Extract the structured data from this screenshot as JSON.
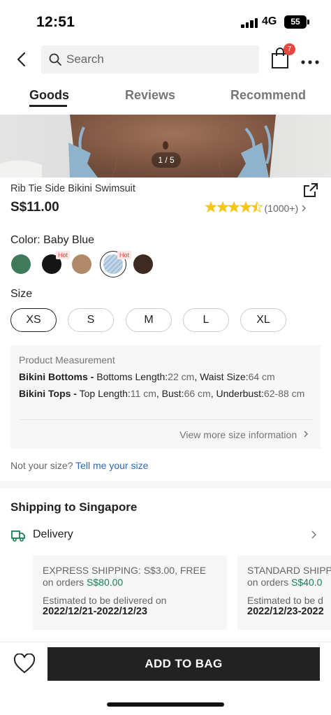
{
  "status_bar": {
    "time": "12:51",
    "network": "4G",
    "battery": "55"
  },
  "nav": {
    "search_placeholder": "Search",
    "cart_count": "7",
    "icons": [
      "back-icon",
      "search-icon",
      "bag-icon",
      "more-icon"
    ]
  },
  "tabs": [
    {
      "label": "Goods",
      "active": true
    },
    {
      "label": "Reviews",
      "active": false
    },
    {
      "label": "Recommend",
      "active": false
    }
  ],
  "gallery": {
    "counter": "1 / 5"
  },
  "product": {
    "title": "Rib Tie Side Bikini Swimsuit",
    "price": "S$11.00",
    "rating_value": 4.5,
    "rating_count": "(1000+)",
    "star_color": "#f5c518"
  },
  "color": {
    "label": "Color: Baby Blue",
    "selected": "Baby Blue",
    "hot_tag": "Hot",
    "swatches": [
      {
        "hex": "#3f7a5b",
        "hot": false
      },
      {
        "hex": "#151515",
        "hot": true
      },
      {
        "hex": "#b08a68",
        "hot": false
      },
      {
        "hex": "#a7c3dc",
        "hot": true,
        "selected": true
      },
      {
        "hex": "#3e2a22",
        "hot": false
      }
    ]
  },
  "size": {
    "label": "Size",
    "options": [
      "XS",
      "S",
      "M",
      "L",
      "XL"
    ],
    "selected": "XS"
  },
  "measurement": {
    "title": "Product Measurement",
    "bottoms": {
      "name": "Bikini Bottoms -",
      "length_label": "Bottoms Length:",
      "length_value": "22 cm",
      "waist_label": "Waist Size:",
      "waist_value": "64 cm"
    },
    "tops": {
      "name": "Bikini Tops -",
      "length_label": "Top Length:",
      "length_value": "11 cm",
      "bust_label": "Bust:",
      "bust_value": "66 cm",
      "underbust_label": "Underbust:",
      "underbust_value": "62-88 cm"
    },
    "view_more": "View more size information"
  },
  "size_help": {
    "question": "Not your size?",
    "link": "Tell me your size"
  },
  "shipping": {
    "title": "Shipping to Singapore",
    "delivery_label": "Delivery",
    "cards": [
      {
        "line1": "EXPRESS SHIPPING: S$3.00, FREE",
        "line2_prefix": "on orders",
        "line2_amount": "S$80.00",
        "line3": "Estimated to be delivered on",
        "dates": "2022/12/21-2022/12/23"
      },
      {
        "line1": "STANDARD SHIPPING",
        "line2_prefix": "on orders",
        "line2_amount": "S$40.0",
        "line3": "Estimated to be d",
        "dates": "2022/12/23-2022"
      }
    ]
  },
  "footer": {
    "add_to_bag": "ADD TO BAG"
  }
}
